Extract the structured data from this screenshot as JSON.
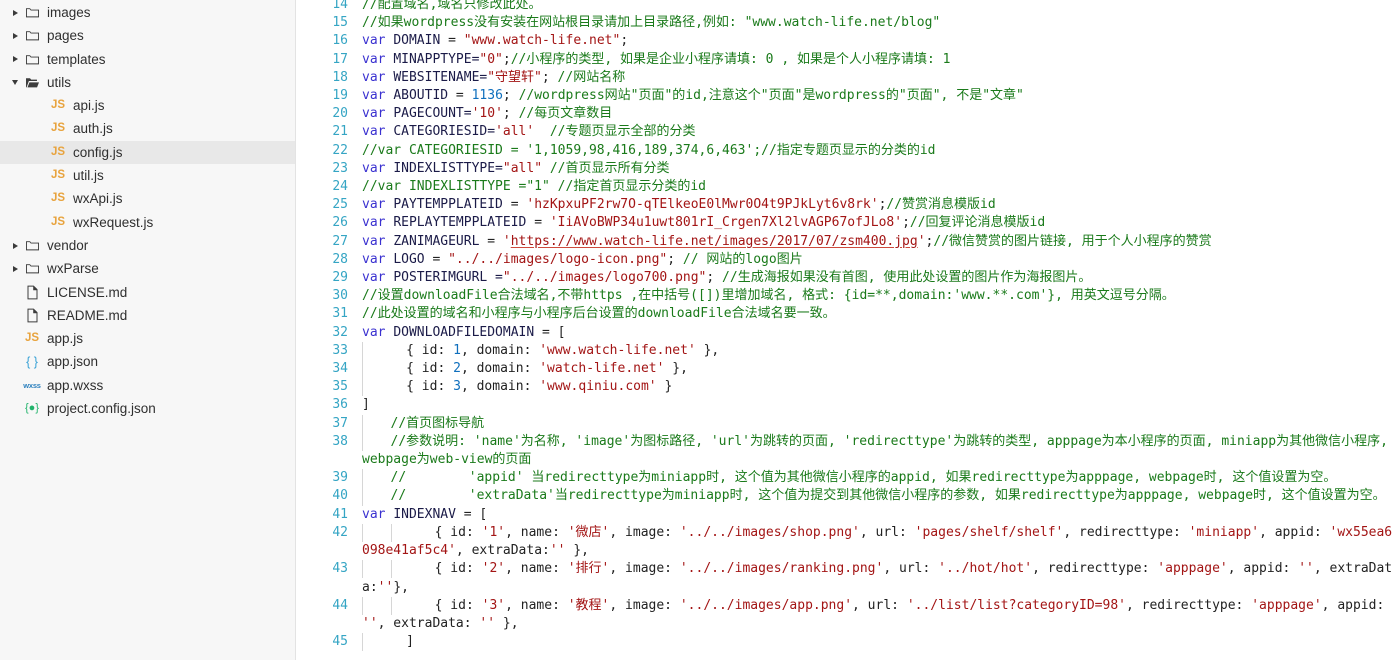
{
  "sidebar": {
    "items": [
      {
        "label": "images",
        "type": "folder",
        "expanded": false,
        "depth": 0,
        "icon": "folder-icon",
        "selected": false
      },
      {
        "label": "pages",
        "type": "folder",
        "expanded": false,
        "depth": 0,
        "icon": "folder-icon",
        "selected": false
      },
      {
        "label": "templates",
        "type": "folder",
        "expanded": false,
        "depth": 0,
        "icon": "folder-icon",
        "selected": false
      },
      {
        "label": "utils",
        "type": "folder",
        "expanded": true,
        "depth": 0,
        "icon": "folder-open-icon",
        "selected": false
      },
      {
        "label": "api.js",
        "type": "js",
        "expanded": null,
        "depth": 1,
        "icon": "js-file-icon",
        "selected": false
      },
      {
        "label": "auth.js",
        "type": "js",
        "expanded": null,
        "depth": 1,
        "icon": "js-file-icon",
        "selected": false
      },
      {
        "label": "config.js",
        "type": "js",
        "expanded": null,
        "depth": 1,
        "icon": "js-file-icon",
        "selected": true
      },
      {
        "label": "util.js",
        "type": "js",
        "expanded": null,
        "depth": 1,
        "icon": "js-file-icon",
        "selected": false
      },
      {
        "label": "wxApi.js",
        "type": "js",
        "expanded": null,
        "depth": 1,
        "icon": "js-file-icon",
        "selected": false
      },
      {
        "label": "wxRequest.js",
        "type": "js",
        "expanded": null,
        "depth": 1,
        "icon": "js-file-icon",
        "selected": false
      },
      {
        "label": "vendor",
        "type": "folder",
        "expanded": false,
        "depth": 0,
        "icon": "folder-icon",
        "selected": false
      },
      {
        "label": "wxParse",
        "type": "folder",
        "expanded": false,
        "depth": 0,
        "icon": "folder-icon",
        "selected": false
      },
      {
        "label": "LICENSE.md",
        "type": "md",
        "expanded": null,
        "depth": 0,
        "icon": "markdown-file-icon",
        "selected": false
      },
      {
        "label": "README.md",
        "type": "md",
        "expanded": null,
        "depth": 0,
        "icon": "markdown-file-icon",
        "selected": false
      },
      {
        "label": "app.js",
        "type": "js",
        "expanded": null,
        "depth": 0,
        "icon": "js-file-icon",
        "selected": false
      },
      {
        "label": "app.json",
        "type": "json",
        "expanded": null,
        "depth": 0,
        "icon": "json-file-icon",
        "selected": false
      },
      {
        "label": "app.wxss",
        "type": "wxss",
        "expanded": null,
        "depth": 0,
        "icon": "wxss-file-icon",
        "selected": false
      },
      {
        "label": "project.config.json",
        "type": "pcfg",
        "expanded": null,
        "depth": 0,
        "icon": "project-config-icon",
        "selected": false
      }
    ],
    "icon_glyphs": {
      "js-file-icon": "JS",
      "json-file-icon": "{ }",
      "wxss-file-icon": "wxss",
      "project-config-icon": "{●}"
    }
  },
  "editor": {
    "first_partial_line": "13",
    "line_numbers": [
      "14",
      "15",
      "16",
      "17",
      "18",
      "19",
      "20",
      "21",
      "22",
      "23",
      "24",
      "25",
      "26",
      "27",
      "28",
      "29",
      "30",
      "31",
      "32",
      "33",
      "34",
      "35",
      "36",
      "37",
      "38",
      "39",
      "40",
      "41",
      "42",
      "43",
      "44",
      "45"
    ],
    "colors": {
      "keyword": "#3a31d0",
      "identifier": "#1b1b48",
      "string": "#a31515",
      "number": "#0f6fbd",
      "comment": "#1a7a1a",
      "linenumber": "#35a5c4",
      "background": "#ffffff",
      "selected_row": "#e8e8e8",
      "sidebar_background": "#f7f7f7"
    },
    "lines": [
      {
        "n": "14",
        "tokens": [
          {
            "t": "c",
            "v": "//配置域名,域名只修改此处。"
          }
        ]
      },
      {
        "n": "15",
        "tokens": [
          {
            "t": "c",
            "v": "//如果wordpress没有安装在网站根目录请加上目录路径,例如: \"www.watch-life.net/blog\""
          }
        ]
      },
      {
        "n": "16",
        "tokens": [
          {
            "t": "k",
            "v": "var"
          },
          {
            "t": "p",
            "v": " "
          },
          {
            "t": "id",
            "v": "DOMAIN"
          },
          {
            "t": "p",
            "v": " = "
          },
          {
            "t": "s",
            "v": "\"www.watch-life.net\""
          },
          {
            "t": "p",
            "v": ";"
          }
        ]
      },
      {
        "n": "17",
        "tokens": [
          {
            "t": "k",
            "v": "var"
          },
          {
            "t": "p",
            "v": " "
          },
          {
            "t": "id",
            "v": "MINAPPTYPE="
          },
          {
            "t": "s",
            "v": "\"0\""
          },
          {
            "t": "p",
            "v": ";"
          },
          {
            "t": "c",
            "v": "//小程序的类型, 如果是企业小程序请填: 0 , 如果是个人小程序请填: 1"
          }
        ]
      },
      {
        "n": "18",
        "tokens": [
          {
            "t": "k",
            "v": "var"
          },
          {
            "t": "p",
            "v": " "
          },
          {
            "t": "id",
            "v": "WEBSITENAME="
          },
          {
            "t": "s",
            "v": "\"守望轩\""
          },
          {
            "t": "p",
            "v": "; "
          },
          {
            "t": "c",
            "v": "//网站名称"
          }
        ]
      },
      {
        "n": "19",
        "tokens": [
          {
            "t": "k",
            "v": "var"
          },
          {
            "t": "p",
            "v": " "
          },
          {
            "t": "id",
            "v": "ABOUTID"
          },
          {
            "t": "p",
            "v": " = "
          },
          {
            "t": "n",
            "v": "1136"
          },
          {
            "t": "p",
            "v": "; "
          },
          {
            "t": "c",
            "v": "//wordpress网站\"页面\"的id,注意这个\"页面\"是wordpress的\"页面\", 不是\"文章\""
          }
        ]
      },
      {
        "n": "20",
        "tokens": [
          {
            "t": "k",
            "v": "var"
          },
          {
            "t": "p",
            "v": " "
          },
          {
            "t": "id",
            "v": "PAGECOUNT="
          },
          {
            "t": "s",
            "v": "'10'"
          },
          {
            "t": "p",
            "v": "; "
          },
          {
            "t": "c",
            "v": "//每页文章数目"
          }
        ]
      },
      {
        "n": "21",
        "tokens": [
          {
            "t": "k",
            "v": "var"
          },
          {
            "t": "p",
            "v": " "
          },
          {
            "t": "id",
            "v": "CATEGORIESID="
          },
          {
            "t": "s",
            "v": "'all'"
          },
          {
            "t": "p",
            "v": "  "
          },
          {
            "t": "c",
            "v": "//专题页显示全部的分类"
          }
        ]
      },
      {
        "n": "22",
        "tokens": [
          {
            "t": "c",
            "v": "//var CATEGORIESID = '1,1059,98,416,189,374,6,463';//指定专题页显示的分类的id"
          }
        ]
      },
      {
        "n": "23",
        "tokens": [
          {
            "t": "k",
            "v": "var"
          },
          {
            "t": "p",
            "v": " "
          },
          {
            "t": "id",
            "v": "INDEXLISTTYPE="
          },
          {
            "t": "s",
            "v": "\"all\""
          },
          {
            "t": "p",
            "v": " "
          },
          {
            "t": "c",
            "v": "//首页显示所有分类"
          }
        ]
      },
      {
        "n": "24",
        "tokens": [
          {
            "t": "c",
            "v": "//var INDEXLISTTYPE =\"1\" //指定首页显示分类的id"
          }
        ]
      },
      {
        "n": "25",
        "tokens": [
          {
            "t": "k",
            "v": "var"
          },
          {
            "t": "p",
            "v": " "
          },
          {
            "t": "id",
            "v": "PAYTEMPPLATEID"
          },
          {
            "t": "p",
            "v": " = "
          },
          {
            "t": "s",
            "v": "'hzKpxuPF2rw7O-qTElkeoE0lMwr0O4t9PJkLyt6v8rk'"
          },
          {
            "t": "p",
            "v": ";"
          },
          {
            "t": "c",
            "v": "//赞赏消息模版id"
          }
        ]
      },
      {
        "n": "26",
        "tokens": [
          {
            "t": "k",
            "v": "var"
          },
          {
            "t": "p",
            "v": " "
          },
          {
            "t": "id",
            "v": "REPLAYTEMPPLATEID"
          },
          {
            "t": "p",
            "v": " = "
          },
          {
            "t": "s",
            "v": "'IiAVoBWP34u1uwt801rI_Crgen7Xl2lvAGP67ofJLo8'"
          },
          {
            "t": "p",
            "v": ";"
          },
          {
            "t": "c",
            "v": "//回复评论消息模版id"
          }
        ]
      },
      {
        "n": "27",
        "tokens": [
          {
            "t": "k",
            "v": "var"
          },
          {
            "t": "p",
            "v": " "
          },
          {
            "t": "id",
            "v": "ZANIMAGEURL"
          },
          {
            "t": "p",
            "v": " = "
          },
          {
            "t": "s",
            "v": "'"
          },
          {
            "t": "surl",
            "v": "https://www.watch-life.net/images/2017/07/zsm400.jpg"
          },
          {
            "t": "s",
            "v": "'"
          },
          {
            "t": "p",
            "v": ";"
          },
          {
            "t": "c",
            "v": "//微信赞赏的图片链接, 用于个人小程序的赞赏"
          }
        ]
      },
      {
        "n": "28",
        "tokens": [
          {
            "t": "k",
            "v": "var"
          },
          {
            "t": "p",
            "v": " "
          },
          {
            "t": "id",
            "v": "LOGO"
          },
          {
            "t": "p",
            "v": " = "
          },
          {
            "t": "s",
            "v": "\"../../images/logo-icon.png\""
          },
          {
            "t": "p",
            "v": "; "
          },
          {
            "t": "c",
            "v": "// 网站的logo图片"
          }
        ]
      },
      {
        "n": "29",
        "tokens": [
          {
            "t": "k",
            "v": "var"
          },
          {
            "t": "p",
            "v": " "
          },
          {
            "t": "id",
            "v": "POSTERIMGURL ="
          },
          {
            "t": "s",
            "v": "\"../../images/logo700.png\""
          },
          {
            "t": "p",
            "v": "; "
          },
          {
            "t": "c",
            "v": "//生成海报如果没有首图, 使用此处设置的图片作为海报图片。"
          }
        ]
      },
      {
        "n": "30",
        "tokens": [
          {
            "t": "c",
            "v": "//设置downloadFile合法域名,不带https ,在中括号([])里增加域名, 格式: {id=**,domain:'www.**.com'}, 用英文逗号分隔。"
          }
        ]
      },
      {
        "n": "31",
        "tokens": [
          {
            "t": "c",
            "v": "//此处设置的域名和小程序与小程序后台设置的downloadFile合法域名要一致。"
          }
        ]
      },
      {
        "n": "32",
        "tokens": [
          {
            "t": "k",
            "v": "var"
          },
          {
            "t": "p",
            "v": " "
          },
          {
            "t": "id",
            "v": "DOWNLOADFILEDOMAIN"
          },
          {
            "t": "p",
            "v": " = ["
          }
        ]
      },
      {
        "n": "33",
        "indent": 1,
        "tokens": [
          {
            "t": "p",
            "v": "  { id: "
          },
          {
            "t": "n",
            "v": "1"
          },
          {
            "t": "p",
            "v": ", domain: "
          },
          {
            "t": "s",
            "v": "'www.watch-life.net'"
          },
          {
            "t": "p",
            "v": " },"
          }
        ]
      },
      {
        "n": "34",
        "indent": 1,
        "tokens": [
          {
            "t": "p",
            "v": "  { id: "
          },
          {
            "t": "n",
            "v": "2"
          },
          {
            "t": "p",
            "v": ", domain: "
          },
          {
            "t": "s",
            "v": "'watch-life.net'"
          },
          {
            "t": "p",
            "v": " },"
          }
        ]
      },
      {
        "n": "35",
        "indent": 1,
        "tokens": [
          {
            "t": "p",
            "v": "  { id: "
          },
          {
            "t": "n",
            "v": "3"
          },
          {
            "t": "p",
            "v": ", domain: "
          },
          {
            "t": "s",
            "v": "'www.qiniu.com'"
          },
          {
            "t": "p",
            "v": " }"
          }
        ]
      },
      {
        "n": "36",
        "tokens": [
          {
            "t": "p",
            "v": "]"
          }
        ]
      },
      {
        "n": "37",
        "indent": 1,
        "tokens": [
          {
            "t": "c",
            "v": "//首页图标导航"
          }
        ]
      },
      {
        "n": "38",
        "indent": 1,
        "tokens": [
          {
            "t": "c",
            "v": "//参数说明: 'name'为名称, 'image'为图标路径, 'url'为跳转的页面, 'redirecttype'为跳转的类型, apppage为本小程序的页面, miniapp为其他微信小程序, webpage为web-view的页面"
          }
        ]
      },
      {
        "n": "39",
        "indent": 1,
        "tokens": [
          {
            "t": "c",
            "v": "//        'appid' 当redirecttype为miniapp时, 这个值为其他微信小程序的appid, 如果redirecttype为apppage, webpage时, 这个值设置为空。"
          }
        ]
      },
      {
        "n": "40",
        "indent": 1,
        "tokens": [
          {
            "t": "c",
            "v": "//        'extraData'当redirecttype为miniapp时, 这个值为提交到其他微信小程序的参数, 如果redirecttype为apppage, webpage时, 这个值设置为空。"
          }
        ]
      },
      {
        "n": "41",
        "tokens": [
          {
            "t": "k",
            "v": "var"
          },
          {
            "t": "p",
            "v": " "
          },
          {
            "t": "id",
            "v": "INDEXNAV"
          },
          {
            "t": "p",
            "v": " = ["
          }
        ]
      },
      {
        "n": "42",
        "indent": 2,
        "tokens": [
          {
            "t": "p",
            "v": "  { id: "
          },
          {
            "t": "s",
            "v": "'1'"
          },
          {
            "t": "p",
            "v": ", name: "
          },
          {
            "t": "s",
            "v": "'微店'"
          },
          {
            "t": "p",
            "v": ", image: "
          },
          {
            "t": "s",
            "v": "'../../images/shop.png'"
          },
          {
            "t": "p",
            "v": ", url: "
          },
          {
            "t": "s",
            "v": "'pages/shelf/shelf'"
          },
          {
            "t": "p",
            "v": ", redirecttype: "
          },
          {
            "t": "s",
            "v": "'miniapp'"
          },
          {
            "t": "p",
            "v": ", appid: "
          },
          {
            "t": "s",
            "v": "'wx55ea6098e41af5c4'"
          },
          {
            "t": "p",
            "v": ", extraData:"
          },
          {
            "t": "s",
            "v": "''"
          },
          {
            "t": "p",
            "v": " },"
          }
        ]
      },
      {
        "n": "43",
        "indent": 2,
        "tokens": [
          {
            "t": "p",
            "v": "  { id: "
          },
          {
            "t": "s",
            "v": "'2'"
          },
          {
            "t": "p",
            "v": ", name: "
          },
          {
            "t": "s",
            "v": "'排行'"
          },
          {
            "t": "p",
            "v": ", image: "
          },
          {
            "t": "s",
            "v": "'../../images/ranking.png'"
          },
          {
            "t": "p",
            "v": ", url: "
          },
          {
            "t": "s",
            "v": "'../hot/hot'"
          },
          {
            "t": "p",
            "v": ", redirecttype: "
          },
          {
            "t": "s",
            "v": "'apppage'"
          },
          {
            "t": "p",
            "v": ", appid: "
          },
          {
            "t": "s",
            "v": "''"
          },
          {
            "t": "p",
            "v": ", extraData:"
          },
          {
            "t": "s",
            "v": "''"
          },
          {
            "t": "p",
            "v": "},"
          }
        ]
      },
      {
        "n": "44",
        "indent": 2,
        "tokens": [
          {
            "t": "p",
            "v": "  { id: "
          },
          {
            "t": "s",
            "v": "'3'"
          },
          {
            "t": "p",
            "v": ", name: "
          },
          {
            "t": "s",
            "v": "'教程'"
          },
          {
            "t": "p",
            "v": ", image: "
          },
          {
            "t": "s",
            "v": "'../../images/app.png'"
          },
          {
            "t": "p",
            "v": ", url: "
          },
          {
            "t": "s",
            "v": "'../list/list?categoryID=98'"
          },
          {
            "t": "p",
            "v": ", redirecttype: "
          },
          {
            "t": "s",
            "v": "'apppage'"
          },
          {
            "t": "p",
            "v": ", appid: "
          },
          {
            "t": "s",
            "v": "''"
          },
          {
            "t": "p",
            "v": ", extraData: "
          },
          {
            "t": "s",
            "v": "''"
          },
          {
            "t": "p",
            "v": " },"
          }
        ]
      },
      {
        "n": "45",
        "indent": 1,
        "tokens": [
          {
            "t": "p",
            "v": "  ]"
          }
        ]
      }
    ]
  }
}
